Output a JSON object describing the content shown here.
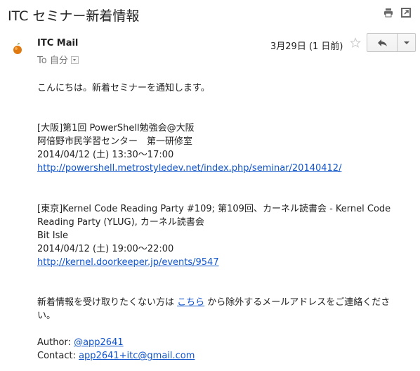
{
  "subject": "ITC セミナー新着情報",
  "header": {
    "sender_name": "ITC Mail",
    "to_label": "To 自分",
    "date": "3月29日 (1 日前)"
  },
  "icons": {
    "print": "print-icon",
    "popout": "new-window-icon",
    "star": "star-icon",
    "reply": "reply-icon",
    "more": "chevron-down-icon"
  },
  "body": {
    "greeting": "こんにちは。新着セミナーを通知します。",
    "seminars": [
      {
        "title": "[大阪]第1回 PowerShell勉強会@大阪",
        "venue": "阿倍野市民学習センター　第一研修室",
        "datetime": "2014/04/12 (土) 13:30～17:00",
        "url": "http://powershell.metrostyledev.net/index.php/seminar/20140412/"
      },
      {
        "title": "[東京]Kernel Code Reading Party #109; 第109回、カーネル読書会 - Kernel Code Reading Party (YLUG), カーネル読書会",
        "venue": "Bit Isle",
        "datetime": "2014/04/12 (土) 19:00～22:00",
        "url": "http://kernel.doorkeeper.jp/events/9547"
      }
    ],
    "unsubscribe": {
      "before": "新着情報を受け取りたくない方は ",
      "link": "こちら",
      "after": " から除外するメールアドレスをご連絡ください。"
    },
    "author_label": "Author: ",
    "author_handle": "@app2641",
    "contact_label": "Contact: ",
    "contact_email": "app2641+itc@gmail.com"
  }
}
